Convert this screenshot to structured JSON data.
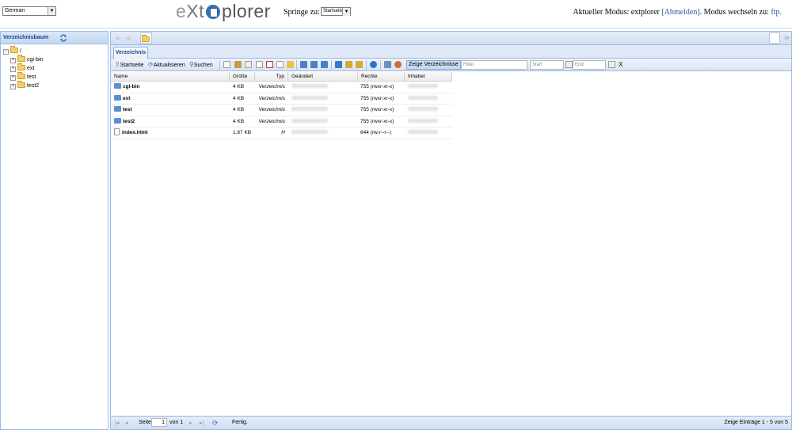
{
  "header": {
    "language_value": "German",
    "logo": {
      "e": "e",
      "x": "Xt",
      "plorer": "plorer"
    },
    "jump_label": "Springe zu:",
    "jump_value": "Startseite",
    "mode_prefix": "Aktueller Modus: extplorer",
    "logout_link": "[Abmelden]",
    "mode_switch_text": ". Modus wechseln zu:",
    "ftp_link": "ftp."
  },
  "sidebar": {
    "title": "Verzeichnisbaum",
    "root": "/",
    "items": [
      "cgi-bin",
      "ext",
      "test",
      "test2"
    ]
  },
  "tabs": {
    "active": "Verzeichnis"
  },
  "toolbar": {
    "home": "Startseite",
    "refresh": "Aktualisieren",
    "search": "Suchen",
    "show_dirs": "Zeige Verzeichnisse",
    "filter_placeholder": "Filter",
    "start_placeholder": "Start",
    "end_placeholder": "End",
    "clear": "X"
  },
  "grid": {
    "columns": [
      "Name",
      "Größe",
      "Typ",
      "Geändert",
      "Rechte",
      "Inhaber"
    ],
    "rows": [
      {
        "name": "cgi-bin",
        "size": "4 KB",
        "type": "Verzeichnis",
        "perms": "755 (rwxr-xr-x)",
        "kind": "folder"
      },
      {
        "name": "ext",
        "size": "4 KB",
        "type": "Verzeichnis",
        "perms": "755 (rwxr-xr-x)",
        "kind": "folder"
      },
      {
        "name": "test",
        "size": "4 KB",
        "type": "Verzeichnis",
        "perms": "755 (rwxr-xr-x)",
        "kind": "folder"
      },
      {
        "name": "test2",
        "size": "4 KB",
        "type": "Verzeichnis",
        "perms": "755 (rwxr-xr-x)",
        "kind": "folder"
      },
      {
        "name": "index.html",
        "size": "1.87 KB",
        "type": "H",
        "perms": "644 (rw-r--r--)",
        "kind": "file"
      }
    ]
  },
  "pager": {
    "page_label": "Seite",
    "page_value": "1",
    "of_label": "von 1",
    "status": "Fertig.",
    "summary": "Zeige Einträge 1 - 5 von 5"
  },
  "colors": {
    "accent": "#15428b",
    "panel_border": "#99bbe8",
    "link": "#2a5aa0"
  }
}
